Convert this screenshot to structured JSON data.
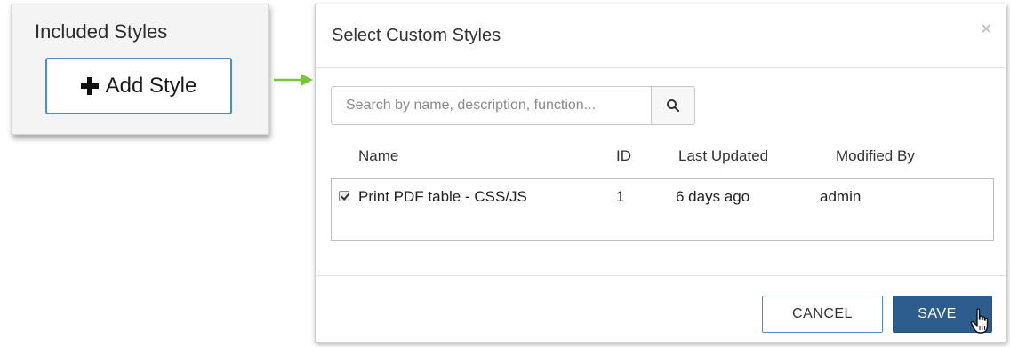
{
  "left_panel": {
    "title": "Included Styles",
    "add_button_label": "Add Style"
  },
  "modal": {
    "title": "Select Custom Styles",
    "close_symbol": "×",
    "search": {
      "placeholder": "Search by name, description, function..."
    },
    "table": {
      "headers": {
        "name": "Name",
        "id": "ID",
        "last_updated": "Last Updated",
        "modified_by": "Modified By"
      },
      "rows": [
        {
          "checked": true,
          "name": "Print PDF table - CSS/JS",
          "id": "1",
          "last_updated": "6 days ago",
          "modified_by": "admin"
        }
      ]
    },
    "footer": {
      "cancel_label": "CANCEL",
      "save_label": "SAVE"
    }
  },
  "colors": {
    "accent_border": "#4a90c8",
    "save_bg": "#2c5d8e",
    "arrow": "#7cc242"
  },
  "icons": {
    "add": "plus-icon",
    "search": "search-icon",
    "close": "close-icon",
    "cursor": "hand-pointer-icon",
    "connector": "arrow-right-icon"
  }
}
